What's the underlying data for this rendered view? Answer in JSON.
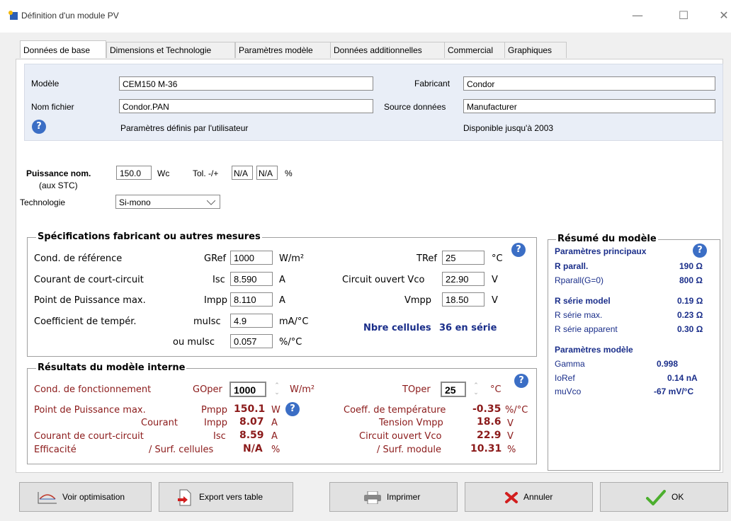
{
  "window": {
    "title": "Définition d'un module PV",
    "minimize": "—",
    "maximize": "☐",
    "close": "✕"
  },
  "tabs": [
    "Données de base",
    "Dimensions et Technologie",
    "Paramètres modèle",
    "Données additionnelles",
    "Commercial",
    "Graphiques"
  ],
  "header": {
    "modele_label": "Modèle",
    "modele_value": "CEM150 M-36",
    "fabricant_label": "Fabricant",
    "fabricant_value": "Condor",
    "nomfichier_label": "Nom fichier",
    "nomfichier_value": "Condor.PAN",
    "source_label": "Source données",
    "source_value": "Manufacturer",
    "params_user": "Paramètres définis par l'utilisateur",
    "disponible": "Disponible jusqu'à 2003"
  },
  "puissance": {
    "label": "Puissance nom.",
    "sublabel": "(aux STC)",
    "value": "150.0",
    "unit": "Wc",
    "tol_label": "Tol. -/+",
    "tol_minus": "N/A",
    "tol_plus": "N/A",
    "tol_unit": "%",
    "techno_label": "Technologie",
    "techno_value": "Si-mono"
  },
  "specs": {
    "title": "Spécifications fabricant ou autres mesures",
    "rows": [
      {
        "label": "Cond. de référence",
        "sym": "GRef",
        "value": "1000",
        "unit": "W/m²"
      },
      {
        "label": "Courant de court-circuit",
        "sym": "Isc",
        "value": "8.590",
        "unit": "A"
      },
      {
        "label": "Point de Puissance max.",
        "sym": "Impp",
        "value": "8.110",
        "unit": "A"
      },
      {
        "label": "Coefficient de tempér.",
        "sym": "muIsc",
        "value": "4.9",
        "unit": "mA/°C"
      },
      {
        "label": "",
        "sym": "ou  muIsc",
        "value": "0.057",
        "unit": "%/°C"
      }
    ],
    "right_rows": [
      {
        "label": "TRef",
        "value": "25",
        "unit": "°C"
      },
      {
        "label": "Circuit ouvert Vco",
        "value": "22.90",
        "unit": "V"
      },
      {
        "label": "Vmpp",
        "value": "18.50",
        "unit": "V"
      }
    ],
    "cells_label": "Nbre cellules",
    "cells_value": "36 en série"
  },
  "results": {
    "title": "Résultats du modèle interne",
    "goper_label": "Cond. de fonctionnement",
    "goper_sym": "GOper",
    "goper_value": "1000",
    "goper_unit": "W/m²",
    "toper_label": "TOper",
    "toper_value": "25",
    "toper_unit": "°C",
    "pmpp_label": "Point de Puissance max.",
    "pmpp_sym": "Pmpp",
    "pmpp_value": "150.1",
    "pmpp_unit": "W",
    "courant_label": "Courant",
    "impp_sym": "Impp",
    "impp_value": "8.07",
    "impp_unit": "A",
    "isc_label": "Courant de court-circuit",
    "isc_sym": "Isc",
    "isc_value": "8.59",
    "isc_unit": "A",
    "eff_label": "Efficacité",
    "eff_sym": "/ Surf. cellules",
    "eff_value": "N/A",
    "eff_unit": "%",
    "coef_label": "Coeff. de température",
    "coef_value": "-0.35",
    "coef_unit": "%/°C",
    "vmpp_label": "Tension Vmpp",
    "vmpp_value": "18.6",
    "vmpp_unit": "V",
    "vco_label": "Circuit ouvert Vco",
    "vco_value": "22.9",
    "vco_unit": "V",
    "surf_label": "/ Surf. module",
    "surf_value": "10.31",
    "surf_unit": "%"
  },
  "resume": {
    "title": "Résumé du modèle",
    "principaux": "Paramètres principaux",
    "rparall_label": "R parall.",
    "rparall_value": "190 Ω",
    "rparall0_label": "Rparall(G=0)",
    "rparall0_value": "800 Ω",
    "rserie_label": "R série model",
    "rserie_value": "0.19 Ω",
    "rseriemax_label": "R série max.",
    "rseriemax_value": "0.23 Ω",
    "rserieapp_label": "R série apparent",
    "rserieapp_value": "0.30 Ω",
    "modele": "Paramètres modèle",
    "gamma_label": "Gamma",
    "gamma_value": "0.998",
    "ioref_label": "IoRef",
    "ioref_value": "0.14 nA",
    "muvco_label": "muVco",
    "muvco_value": "-67 mV/°C"
  },
  "buttons": {
    "optimisation": "Voir optimisation",
    "export": "Export vers table",
    "imprimer": "Imprimer",
    "annuler": "Annuler",
    "ok": "OK"
  },
  "colors": {
    "accent_red": "#8b1a1a",
    "accent_navy": "#1a2e8a",
    "help_blue": "#3b6ec5"
  }
}
